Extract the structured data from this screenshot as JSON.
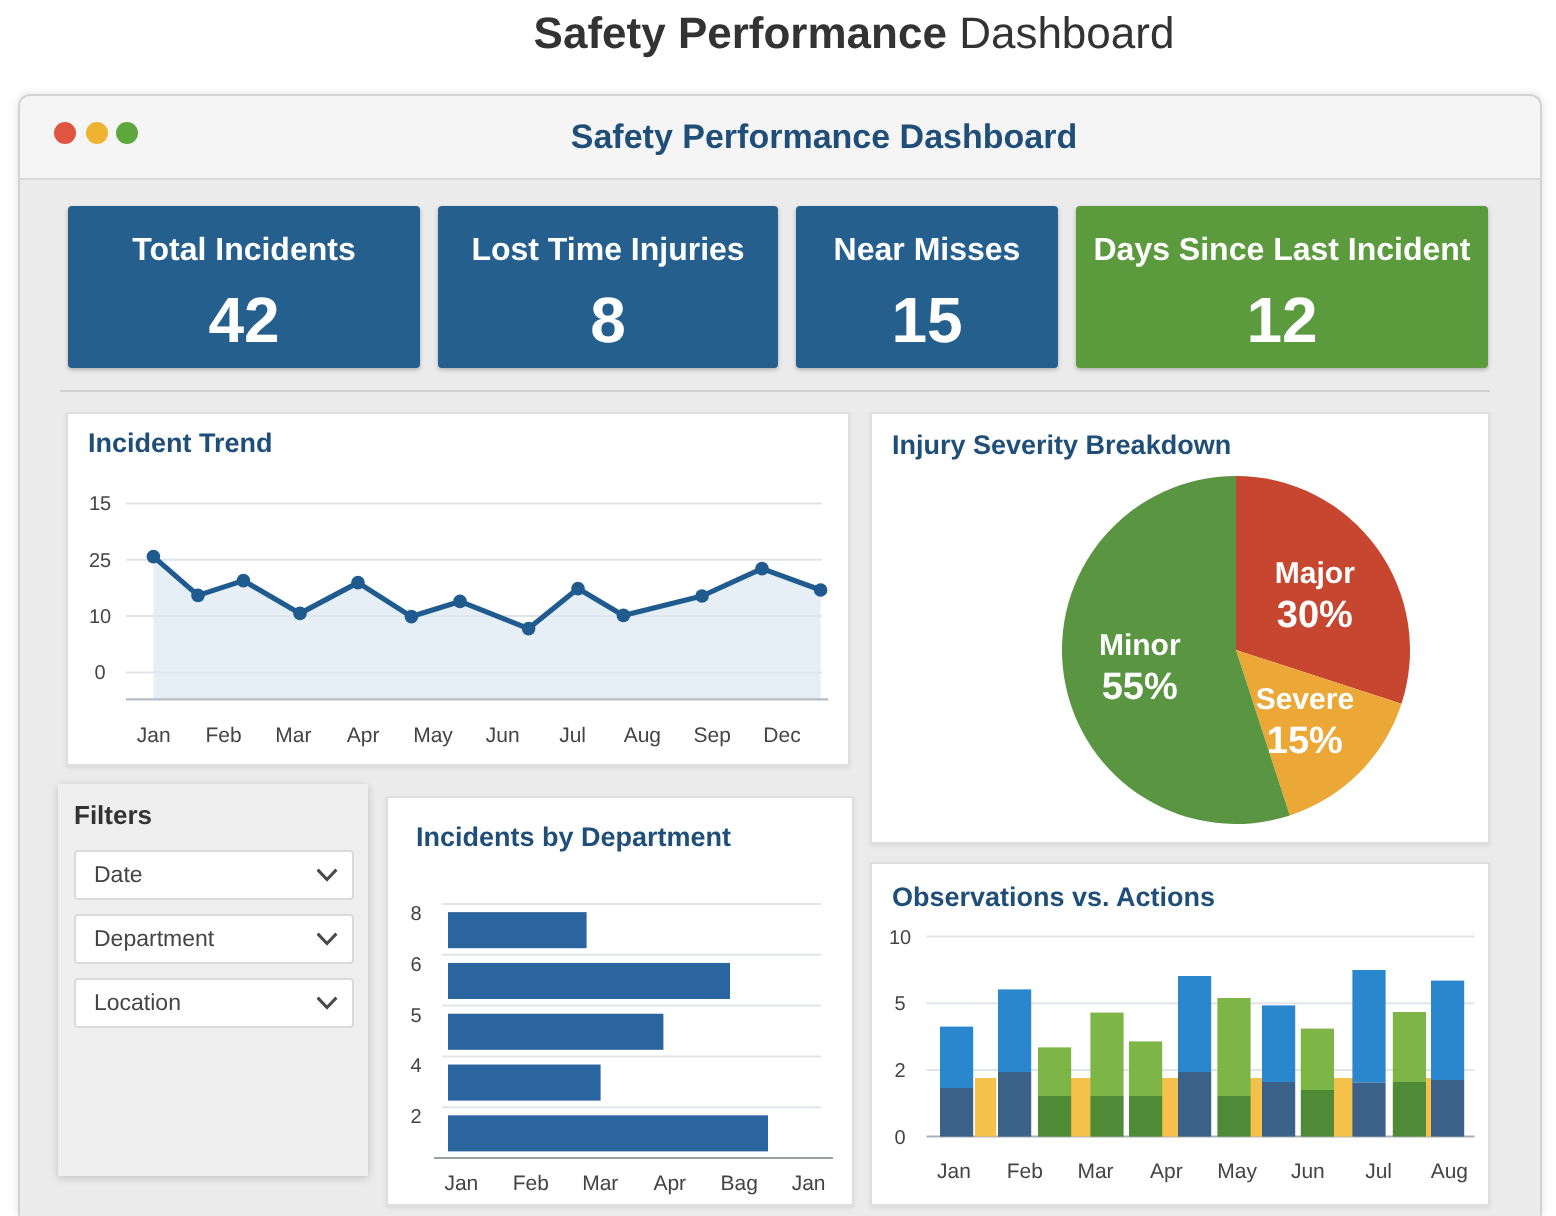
{
  "page_title": "**Safety Performance** Dashboard",
  "window": {
    "title": "Safety Performance Dashboard"
  },
  "kpis": [
    {
      "label": "Total Incidents",
      "value": "42",
      "color": "#245f8e"
    },
    {
      "label": "Lost Time Injuries",
      "value": "8",
      "color": "#245f8e"
    },
    {
      "label": "Near Misses",
      "value": "15",
      "color": "#245f8e"
    },
    {
      "label": "Days Since Last Incident",
      "value": "12",
      "color": "#5b9a3d"
    }
  ],
  "incident_trend": {
    "title": "Incident Trend",
    "y_axis_labels": [
      "15",
      "25",
      "10",
      "0"
    ],
    "x_axis_labels": [
      "Jan",
      "Feb",
      "Mar",
      "Apr",
      "May",
      "Jun",
      "Jul",
      "Aug",
      "Sep",
      "Dec"
    ]
  },
  "injury_severity": {
    "title": "Injury Severity Breakdown",
    "chart_data": {
      "type": "pie",
      "categories": [
        "Major",
        "Severe",
        "Minor"
      ],
      "values": [
        30,
        15,
        55
      ],
      "colors": [
        "#c6462f",
        "#eba836",
        "#5a9541"
      ],
      "value_labels": [
        "30%",
        "15%",
        "55%"
      ]
    }
  },
  "filters": {
    "title": "Filters",
    "dropdowns": [
      {
        "label": "Date"
      },
      {
        "label": "Department"
      },
      {
        "label": "Location"
      }
    ]
  },
  "incidents_by_department": {
    "title": "Incidents by Department",
    "y_axis_labels": [
      "8",
      "6",
      "5",
      "4",
      "2"
    ],
    "x_axis_labels": [
      "Jan",
      "Feb",
      "Mar",
      "Apr",
      "Bag",
      "Jan"
    ]
  },
  "observations_vs_actions": {
    "title": "Observations vs. Actions",
    "y_axis_labels": [
      "10",
      "5",
      "2",
      "0"
    ],
    "x_axis_labels": [
      "Jan",
      "Feb",
      "Mar",
      "Apr",
      "May",
      "Jun",
      "Jul",
      "Aug"
    ]
  }
}
